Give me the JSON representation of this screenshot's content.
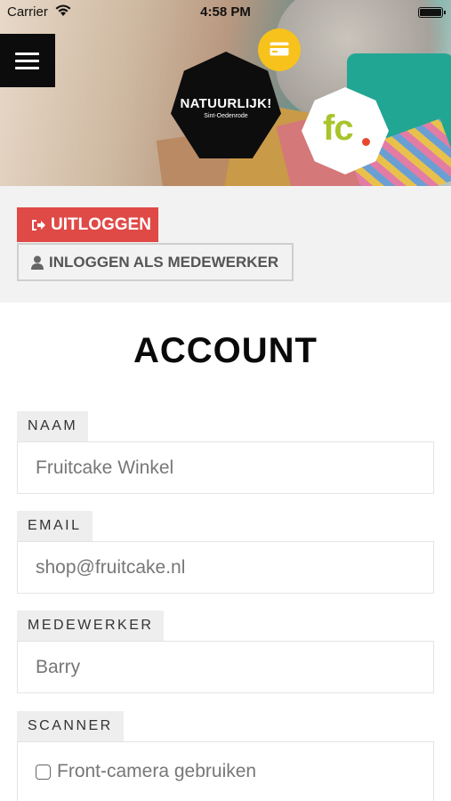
{
  "status_bar": {
    "carrier": "Carrier",
    "time": "4:58 PM"
  },
  "logos": {
    "natuurlijk_title": "NATUURLIJK!",
    "natuurlijk_subtitle": "Sint-Oedenrode",
    "fc_text": "fc"
  },
  "actions": {
    "logout_label": "UITLOGGEN",
    "staff_login_label": "INLOGGEN ALS MEDEWERKER"
  },
  "page": {
    "title": "ACCOUNT"
  },
  "fields": {
    "naam": {
      "label": "NAAM",
      "value": "Fruitcake Winkel"
    },
    "email": {
      "label": "EMAIL",
      "value": "shop@fruitcake.nl"
    },
    "medewerker": {
      "label": "MEDEWERKER",
      "value": "Barry"
    },
    "scanner": {
      "label": "SCANNER",
      "option_label": "Front-camera gebruiken",
      "checked": false
    }
  },
  "colors": {
    "logout_red": "#df4a47",
    "badge_yellow": "#f7c21b",
    "fc_green": "#a8c42b",
    "fc_dot": "#e8492e"
  }
}
